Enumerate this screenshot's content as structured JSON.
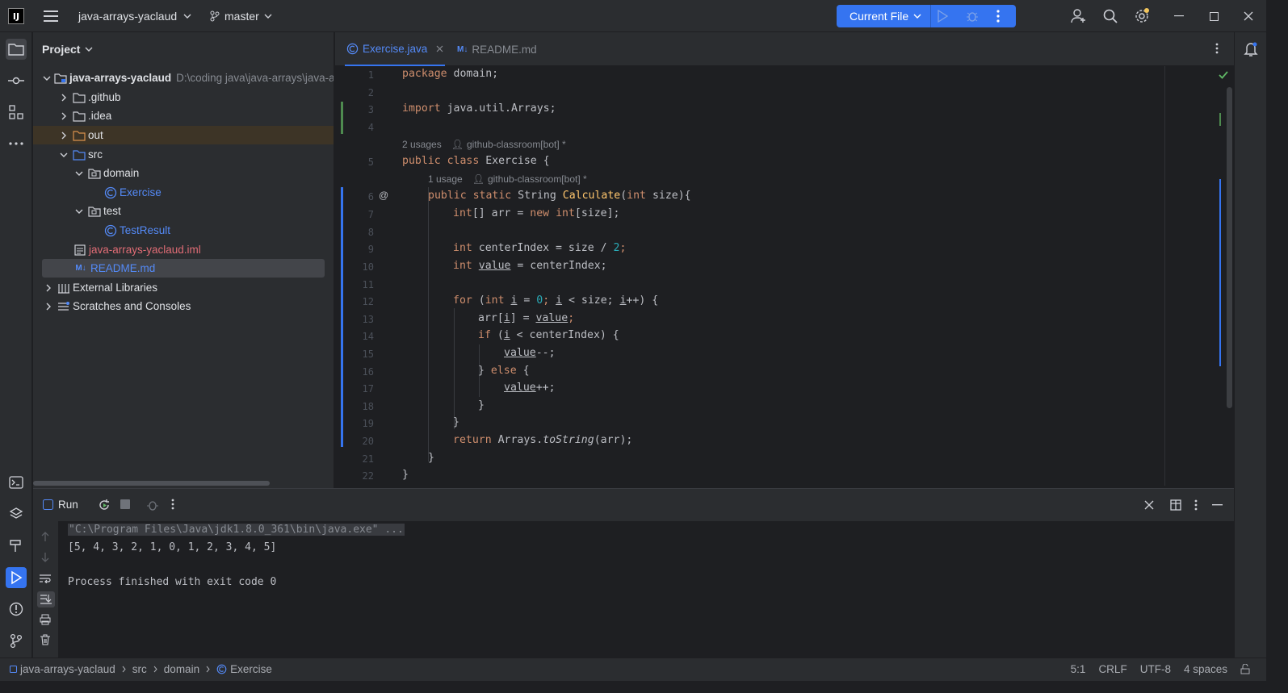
{
  "titlebar": {
    "logo_text": "IJ",
    "project_name": "java-arrays-yaclaud",
    "branch": "master",
    "run_config": "Current File"
  },
  "project_panel": {
    "title": "Project",
    "items": [
      {
        "label": "java-arrays-yaclaud",
        "path": "D:\\coding java\\java-arrays\\java-a"
      },
      {
        "label": ".github"
      },
      {
        "label": ".idea"
      },
      {
        "label": "out"
      },
      {
        "label": "src"
      },
      {
        "label": "domain"
      },
      {
        "label": "Exercise"
      },
      {
        "label": "test"
      },
      {
        "label": "TestResult"
      },
      {
        "label": "java-arrays-yaclaud.iml"
      },
      {
        "label": "README.md"
      },
      {
        "label": "External Libraries"
      },
      {
        "label": "Scratches and Consoles"
      }
    ]
  },
  "tabs": [
    {
      "label": "Exercise.java",
      "active": true
    },
    {
      "label": "README.md",
      "active": false
    }
  ],
  "editor": {
    "line_numbers": [
      "1",
      "2",
      "3",
      "4",
      "5",
      "6",
      "7",
      "8",
      "9",
      "10",
      "11",
      "12",
      "13",
      "14",
      "15",
      "16",
      "17",
      "18",
      "19",
      "20",
      "21",
      "22"
    ],
    "hints": {
      "class_usages": "2 usages",
      "class_author": "github-classroom[bot] *",
      "method_usages": "1 usage",
      "method_author": "github-classroom[bot] *"
    },
    "lines": {
      "l1_kw": "package",
      "l1_rest": " domain;",
      "l3_kw": "import",
      "l3_rest": " java.util.Arrays;",
      "l5_kw": "public class",
      "l5_rest": " Exercise {",
      "l6_kw1": "public static",
      "l6_type": " String ",
      "l6_name": "Calculate",
      "l6_p1": "(",
      "l6_kw2": "int",
      "l6_p2": " size){",
      "l7_kw": "int",
      "l7_a": "[] arr = ",
      "l7_new": "new",
      "l7_sp": " ",
      "l7_int": "int",
      "l7_b": "[size];",
      "l9_kw": "int",
      "l9_a": " centerIndex = size / ",
      "l9_num": "2",
      "l9_b": ";",
      "l10_kw": "int",
      "l10_sp": " ",
      "l10_var": "value",
      "l10_b": " = centerIndex;",
      "l12_for": "for",
      "l12_a": " (",
      "l12_int": "int",
      "l12_sp": " ",
      "l12_i": "i",
      "l12_eq": " = ",
      "l12_zero": "0",
      "l12_sc": "; ",
      "l12_i2": "i",
      "l12_lt": " < size; ",
      "l12_i3": "i",
      "l12_end": "++) {",
      "l13_a": "arr[",
      "l13_i": "i",
      "l13_b": "] = ",
      "l13_v": "value",
      "l13_c": ";",
      "l14_if": "if",
      "l14_a": " (",
      "l14_i": "i",
      "l14_b": " < centerIndex) {",
      "l15_v": "value",
      "l15_b": "--;",
      "l16_a": "} ",
      "l16_else": "else",
      "l16_b": " {",
      "l17_v": "value",
      "l17_b": "++;",
      "l18": "}",
      "l19": "}",
      "l20_ret": "return",
      "l20_a": " Arrays.",
      "l20_m": "toString",
      "l20_b": "(arr);",
      "l21": "}",
      "l22": "}"
    }
  },
  "run_panel": {
    "title": "Run",
    "command": "\"C:\\Program Files\\Java\\jdk1.8.0_361\\bin\\java.exe\" ...",
    "output": "[5, 4, 3, 2, 1, 0, 1, 2, 3, 4, 5]",
    "finished": "Process finished with exit code 0"
  },
  "statusbar": {
    "crumbs": [
      "java-arrays-yaclaud",
      "src",
      "domain",
      "Exercise"
    ],
    "position": "5:1",
    "line_sep": "CRLF",
    "encoding": "UTF-8",
    "indent": "4 spaces"
  },
  "colors": {
    "accent": "#3574f0",
    "keyword": "#cf8e6d",
    "number": "#2aacb8",
    "method_decl": "#ffc66d",
    "error_file": "#e06c75"
  }
}
